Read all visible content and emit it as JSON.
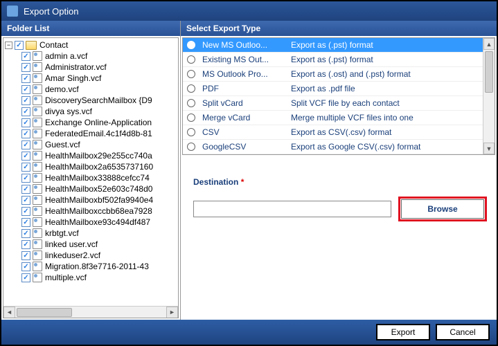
{
  "window": {
    "title": "Export Option"
  },
  "left_header": "Folder List",
  "right_header": "Select Export Type",
  "tree": {
    "root": "Contact",
    "items": [
      "admin a.vcf",
      "Administrator.vcf",
      "Amar Singh.vcf",
      "demo.vcf",
      "DiscoverySearchMailbox {D9",
      "divya sys.vcf",
      "Exchange Online-Application",
      "FederatedEmail.4c1f4d8b-81",
      "Guest.vcf",
      "HealthMailbox29e255cc740a",
      "HealthMailbox2a6535737160",
      "HealthMailbox33888cefcc74",
      "HealthMailbox52e603c748d0",
      "HealthMailboxbf502fa9940e4",
      "HealthMailboxccbb68ea7928",
      "HealthMailboxe93c494df487",
      "krbtgt.vcf",
      "linked user.vcf",
      "linkeduser2.vcf",
      "Migration.8f3e7716-2011-43",
      "multiple.vcf"
    ]
  },
  "export_types": [
    {
      "name": "New MS Outloo...",
      "desc": "Export as (.pst) format",
      "selected": true
    },
    {
      "name": "Existing MS Out...",
      "desc": "Export as (.pst) format",
      "selected": false
    },
    {
      "name": "MS Outlook Pro...",
      "desc": "Export as (.ost) and (.pst) format",
      "selected": false
    },
    {
      "name": "PDF",
      "desc": "Export as .pdf file",
      "selected": false
    },
    {
      "name": "Split vCard",
      "desc": "Split VCF file by each contact",
      "selected": false
    },
    {
      "name": "Merge vCard",
      "desc": "Merge multiple VCF files into one",
      "selected": false
    },
    {
      "name": "CSV",
      "desc": "Export as CSV(.csv) format",
      "selected": false
    },
    {
      "name": "GoogleCSV",
      "desc": "Export as Google CSV(.csv) format",
      "selected": false
    }
  ],
  "destination": {
    "label": "Destination",
    "required": "*",
    "value": "",
    "browse": "Browse"
  },
  "footer": {
    "export": "Export",
    "cancel": "Cancel"
  }
}
